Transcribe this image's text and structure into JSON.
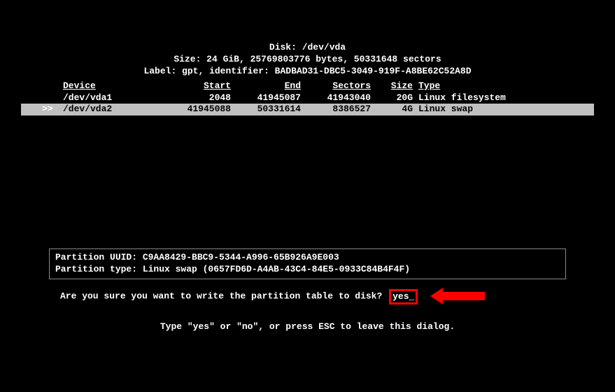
{
  "header": {
    "disk_label": "Disk: /dev/vda",
    "size_line": "Size: 24 GiB, 25769803776 bytes, 50331648 sectors",
    "label_line": "Label: gpt, identifier: BADBAD31-DBC5-3049-919F-A8BE62C52A8D"
  },
  "table": {
    "columns": {
      "device": "Device",
      "start": "Start",
      "end": "End",
      "sectors": "Sectors",
      "size": "Size",
      "type": "Type"
    },
    "rows": [
      {
        "device": "/dev/vda1",
        "start": "2048",
        "end": "41945087",
        "sectors": "41943040",
        "size": "20G",
        "type": "Linux filesystem",
        "selected": false
      },
      {
        "device": "/dev/vda2",
        "start": "41945088",
        "end": "50331614",
        "sectors": "8386527",
        "size": "4G",
        "type": "Linux swap",
        "selected": true
      }
    ],
    "selection_marker": ">>"
  },
  "info": {
    "uuid_line": "Partition UUID: C9AA8429-BBC9-5344-A996-65B926A9E003",
    "type_line": "Partition type: Linux swap (0657FD6D-A4AB-43C4-84E5-0933C84B4F4F)"
  },
  "prompt": {
    "question": "Are you sure you want to write the partition table to disk?",
    "input_value": "yes_",
    "hint": "Type \"yes\" or \"no\", or press ESC to leave this dialog."
  },
  "annotation": {
    "highlight_color": "#ff0000"
  }
}
